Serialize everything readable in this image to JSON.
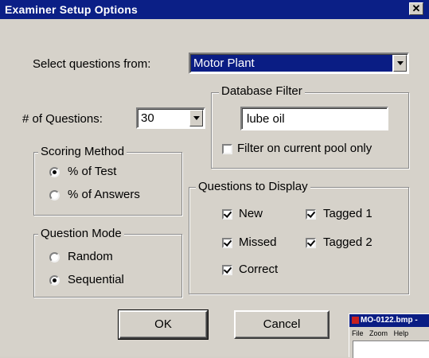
{
  "window": {
    "title": "Examiner Setup Options",
    "close_glyph": "✕"
  },
  "select_questions": {
    "label": "Select questions from:",
    "value": "Motor Plant"
  },
  "num_questions": {
    "label": "# of Questions:",
    "value": "30"
  },
  "database_filter": {
    "title": "Database Filter",
    "value": "lube oil",
    "checkbox_label": "Filter on current pool only",
    "checked": false
  },
  "scoring_method": {
    "title": "Scoring Method",
    "options": [
      {
        "label": "% of Test",
        "selected": true
      },
      {
        "label": "% of Answers",
        "selected": false
      }
    ]
  },
  "question_mode": {
    "title": "Question Mode",
    "options": [
      {
        "label": "Random",
        "selected": false
      },
      {
        "label": "Sequential",
        "selected": true
      }
    ]
  },
  "questions_to_display": {
    "title": "Questions to Display",
    "items": [
      {
        "label": "New",
        "checked": true
      },
      {
        "label": "Tagged 1",
        "checked": true
      },
      {
        "label": "Missed",
        "checked": true
      },
      {
        "label": "Tagged 2",
        "checked": true
      },
      {
        "label": "Correct",
        "checked": true
      }
    ]
  },
  "buttons": {
    "ok": "OK",
    "cancel": "Cancel"
  },
  "mini_window": {
    "title": "MO-0122.bmp -",
    "menu": [
      "File",
      "Zoom",
      "Help"
    ]
  },
  "colors": {
    "titlebar": "#0b1f86",
    "face": "#d6d2ca",
    "field": "#ffffff"
  }
}
